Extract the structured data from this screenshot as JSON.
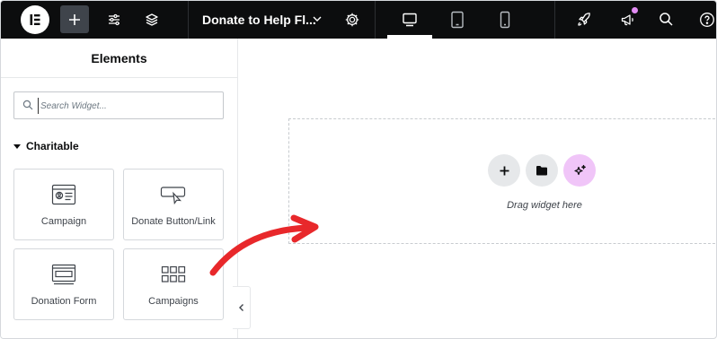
{
  "topbar": {
    "add_icon": "plus-icon",
    "settings_icon": "sliders-icon",
    "structure_icon": "layers-icon",
    "document_title": "Donate to Help Fl...",
    "title_chevron_icon": "chevron-down-icon",
    "page_settings_icon": "gear-icon",
    "devices": [
      "desktop",
      "tablet",
      "mobile"
    ],
    "active_device": "desktop",
    "publish_icon": "rocket-icon",
    "notifications_icon": "megaphone-icon",
    "search_icon": "search-icon",
    "help_icon": "help-icon",
    "badge_color": "#e28cf3"
  },
  "sidebar": {
    "header": "Elements",
    "search_placeholder": "Search Widget...",
    "category": "Charitable",
    "widgets": [
      {
        "label": "Campaign",
        "icon": "campaign-card-icon"
      },
      {
        "label": "Donate Button/Link",
        "icon": "button-cursor-icon"
      },
      {
        "label": "Donation Form",
        "icon": "form-window-icon"
      },
      {
        "label": "Campaigns",
        "icon": "grid-icon"
      }
    ]
  },
  "canvas": {
    "drop_text": "Drag widget here",
    "ai_color": "#f0c5f8"
  },
  "annotation": {
    "arrow_color": "#e8282b"
  }
}
